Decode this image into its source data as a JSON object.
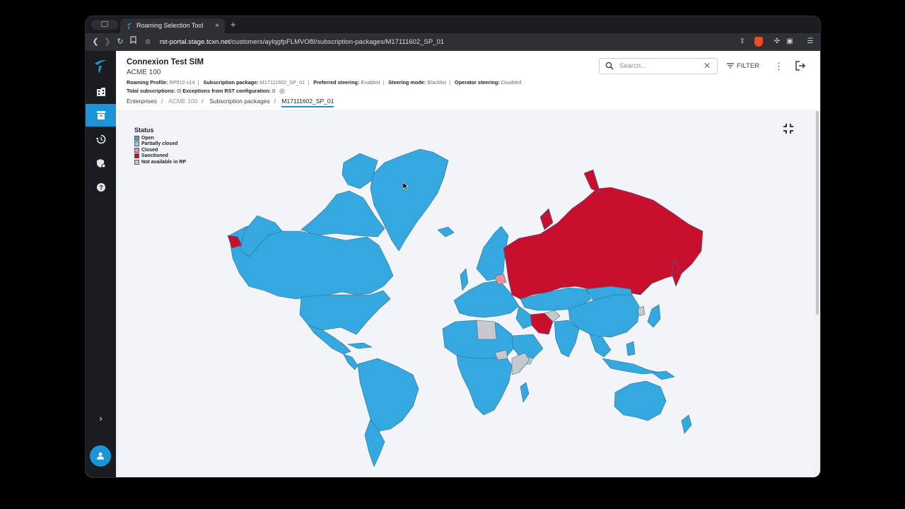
{
  "browser": {
    "tab_title": "Roaming Selection Tool",
    "tab_close": "×",
    "new_tab": "+",
    "url_prefix": "rst-portal.stage.tcxn.net",
    "url_path": "/customers/aylqgfpFLMVO8I/subscription-packages/M17111602_SP_01"
  },
  "sidebar": {
    "items": [
      {
        "icon": "enterprise-icon",
        "active": false
      },
      {
        "icon": "package-icon",
        "active": true
      },
      {
        "icon": "history-icon",
        "active": false
      },
      {
        "icon": "security-settings-icon",
        "active": false
      },
      {
        "icon": "help-icon",
        "active": false
      }
    ],
    "expand": "›"
  },
  "header": {
    "title": "Connexion Test SIM",
    "subtitle": "ACME 100",
    "meta": {
      "roaming_profile_label": "Roaming Profile:",
      "roaming_profile_value": "RP910 v14",
      "subscription_package_label": "Subscription package:",
      "subscription_package_value": "M17111602_SP_01",
      "preferred_steering_label": "Preferred steering:",
      "preferred_steering_value": "Enabled",
      "steering_mode_label": "Steering mode:",
      "steering_mode_value": "Blacklist",
      "operator_steering_label": "Operator steering:",
      "operator_steering_value": "Disabled",
      "total_subscriptions_label": "Total subscriptions:",
      "total_subscriptions_value": "0",
      "exceptions_label": "Exceptions from RST configuration:",
      "exceptions_value": "0"
    },
    "breadcrumbs": [
      "Enterprises",
      "ACME 100",
      "Subscription packages",
      "M17111602_SP_01"
    ],
    "search_placeholder": "Search...",
    "filter_label": "FILTER"
  },
  "map": {
    "legend_title": "Status",
    "legend": [
      {
        "label": "Open",
        "color": "#35a8e0"
      },
      {
        "label": "Partially closed",
        "color": "#8fd3f0"
      },
      {
        "label": "Closed",
        "color": "#e8909c"
      },
      {
        "label": "Sanctioned",
        "color": "#c8102e"
      },
      {
        "label": "Not available in RP",
        "color": "#c6c8cc"
      }
    ]
  }
}
